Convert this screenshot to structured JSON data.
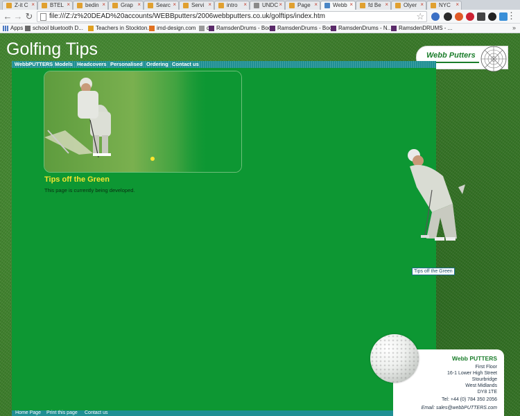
{
  "browser": {
    "tabs": [
      {
        "label": "Z-it C",
        "icon_color": "#e0a030"
      },
      {
        "label": "BTEL",
        "icon_color": "#e0a030"
      },
      {
        "label": "bedin",
        "icon_color": "#e0a030"
      },
      {
        "label": "Grap",
        "icon_color": "#e0a030"
      },
      {
        "label": "Searc",
        "icon_color": "#e0a030"
      },
      {
        "label": "Servi",
        "icon_color": "#e0a030"
      },
      {
        "label": "intro",
        "icon_color": "#e0a030"
      },
      {
        "label": "UNDC",
        "icon_color": "#8a8a8a"
      },
      {
        "label": "Page",
        "icon_color": "#e0a030"
      },
      {
        "label": "Webb",
        "icon_color": "#4a86c5",
        "active": true
      },
      {
        "label": "fd Be",
        "icon_color": "#e0a030"
      },
      {
        "label": "Olyer",
        "icon_color": "#e0a030"
      },
      {
        "label": "NYC",
        "icon_color": "#e0a030"
      }
    ],
    "url": "file:///Z:/z%20DEAD%20accounts/WEBBputters/2006webbputters.co.uk/golftips/index.htm",
    "bookmarks": [
      {
        "label": "Apps"
      },
      {
        "label": "school bluetooth D..."
      },
      {
        "label": "Teachers in Stockton..."
      },
      {
        "label": "imd-design.com"
      },
      {
        "label": "q"
      },
      {
        "label": "RamsdenDrums - Boo..."
      },
      {
        "label": "RamsdenDrums - Boo..."
      },
      {
        "label": "RamsdenDrums - N..."
      },
      {
        "label": "RamsdenDRUMS - ..."
      }
    ],
    "bookmarks_more": "»"
  },
  "site": {
    "title": "Golfing Tips",
    "logo_text": "Webb Putters",
    "nav": [
      "WebbPUTTERS",
      "Models",
      "Headcovers",
      "Personalised",
      "Ordering",
      "Contact us"
    ],
    "heading": "Tips off the Green",
    "body": "This page is currently being developed.",
    "side_caption": "Tips off the Green",
    "address": {
      "company": "Webb PUTTERS",
      "lines": [
        "First Floor",
        "16-1 Lower High Street",
        "Stourbridge",
        "West Midlands",
        "DY8 1TE"
      ],
      "tel": "Tel: +44 (0) 784 350 2056",
      "email": "Email: sales@webbPUTTERS.com"
    },
    "footer": [
      "Home Page",
      "Print this page",
      "Contact us"
    ]
  }
}
